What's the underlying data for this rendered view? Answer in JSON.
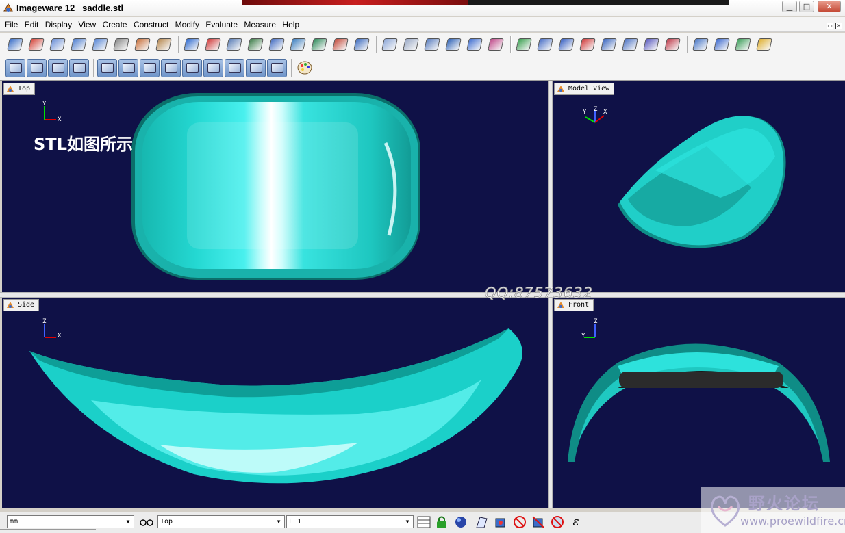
{
  "window": {
    "app_name": "Imageware 12",
    "file_name": "saddle.stl",
    "controls": [
      "minimize",
      "maximize",
      "close"
    ]
  },
  "menu": {
    "items": [
      "File",
      "Edit",
      "Display",
      "View",
      "Create",
      "Construct",
      "Modify",
      "Evaluate",
      "Measure",
      "Help"
    ]
  },
  "toolbar": {
    "row1_icons": [
      "open-file-icon",
      "point-cloud-icon",
      "scan-icon",
      "plane-icon",
      "cube-icon",
      "circuit-icon",
      "cone-mesh-icon",
      "shell-icon",
      "surface-blue-icon",
      "surface-red-icon",
      "blend-icon",
      "ruled-surface-icon",
      "sweep-icon",
      "loft-icon",
      "rectangle-surface-icon",
      "fold-icon",
      "pyramid-icon",
      "wire-box-icon",
      "wire-cube-icon",
      "node-network-icon",
      "cylinder-icon",
      "cross-section-icon",
      "curve-points-icon",
      "color-surface-icon",
      "align-icon",
      "patch-icon",
      "arrow-split-icon",
      "tape-icon",
      "panel-icon",
      "probe-icon",
      "magnet-icon",
      "fillet-icon",
      "offset-icon",
      "layers-icon",
      "gradient-icon"
    ],
    "row2_icons": [
      "cloud-display-icon",
      "curve-display-icon",
      "surface-display-icon",
      "mesh-display-icon",
      "grid-icon",
      "lightning-icon",
      "wave-icon",
      "flow-icon",
      "sweep-curve-icon",
      "graph-curve-icon",
      "sheet-icon",
      "cross-icon",
      "no-entry-icon",
      "palette-icon"
    ]
  },
  "viewports": {
    "top": {
      "label": "Top",
      "axes": [
        "Y",
        "X"
      ]
    },
    "model": {
      "label": "Model View",
      "axes": [
        "Y",
        "Z",
        "X"
      ]
    },
    "side": {
      "label": "Side",
      "axes": [
        "Z",
        "X"
      ]
    },
    "front": {
      "label": "Front",
      "axes": [
        "Z",
        "Y"
      ]
    }
  },
  "annotation": {
    "caption": "STL如图所示",
    "qq_watermark": "QQ:87573632"
  },
  "statusbar": {
    "units": "mm",
    "view": "Top",
    "layer": "L 1",
    "icons": [
      "glasses-icon",
      "window-grid-icon",
      "lock-icon",
      "globe-icon",
      "flag-icon",
      "render-cube-icon",
      "no-entry-icon",
      "render-off-icon",
      "no-entry-icon-2",
      "epsilon-icon"
    ],
    "epsilon": "ε"
  },
  "branding": {
    "forum_name": "野火论坛",
    "forum_url": "www.proewildfire.cn"
  },
  "colors": {
    "viewport_bg": "#0f1147",
    "model_cyan": "#23e5dd",
    "model_highlight": "#e8ffff",
    "model_shadow": "#0c7f78"
  }
}
